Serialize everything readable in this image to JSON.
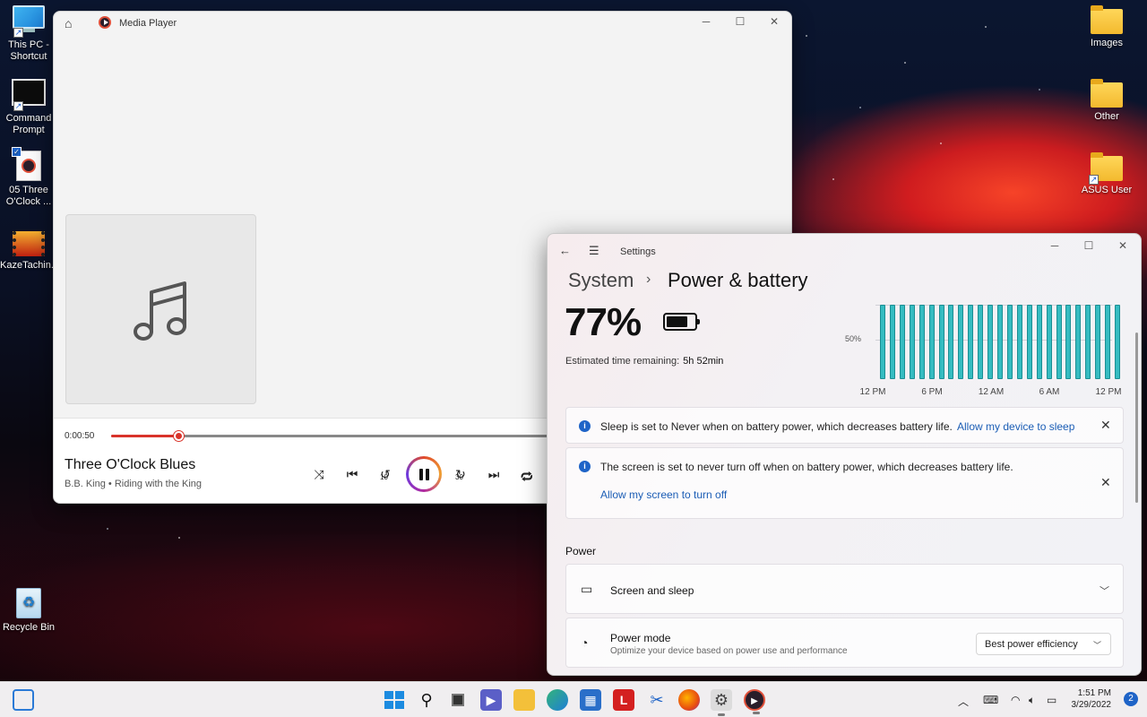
{
  "desktop": {
    "icons_left": [
      {
        "label": "This PC - Shortcut",
        "icon": "monitor-icon"
      },
      {
        "label": "Command Prompt",
        "icon": "terminal-icon"
      },
      {
        "label": "05 Three O'Clock ...",
        "icon": "media-file-icon"
      },
      {
        "label": "KazeTachin...",
        "icon": "video-file-icon"
      },
      {
        "label": "Recycle Bin",
        "icon": "recycle-bin-icon"
      }
    ],
    "icons_right": [
      {
        "label": "Images",
        "icon": "folder-icon"
      },
      {
        "label": "Other",
        "icon": "folder-icon"
      },
      {
        "label": "ASUS User",
        "icon": "folder-icon"
      }
    ]
  },
  "media_player": {
    "window_title": "Media Player",
    "current_time": "0:00:50",
    "progress": 0.15,
    "track_title": "Three O'Clock Blues",
    "track_subtitle": "B.B. King • Riding with the King",
    "skip_back_label": "10",
    "skip_forward_label": "30"
  },
  "settings": {
    "window_title": "Settings",
    "breadcrumb_parent": "System",
    "breadcrumb_sep": "›",
    "page_title": "Power & battery",
    "battery_percent": "77%",
    "battery_level": 0.77,
    "est_label": "Estimated time remaining:",
    "est_value": "5h 52min",
    "chart_data": {
      "type": "bar",
      "ylabel_tick": "50%",
      "x_tick_labels": [
        "12 PM",
        "6 PM",
        "12 AM",
        "6 AM",
        "12 PM"
      ],
      "values": [
        100,
        100,
        100,
        100,
        100,
        100,
        100,
        100,
        100,
        100,
        100,
        100,
        100,
        100,
        100,
        100,
        100,
        100,
        100,
        100,
        100,
        100,
        100,
        100,
        100
      ],
      "ylim": [
        0,
        100
      ]
    },
    "notice_sleep": {
      "text": "Sleep is set to Never when on battery power, which decreases battery life.",
      "link": "Allow my device to sleep"
    },
    "notice_screen": {
      "text": "The screen is set to never turn off when on battery power, which decreases battery life.",
      "link": "Allow my screen to turn off"
    },
    "section_power": "Power",
    "card_screen_sleep": "Screen and sleep",
    "card_power_mode": {
      "title": "Power mode",
      "subtitle": "Optimize your device based on power use and performance",
      "value": "Best power efficiency"
    }
  },
  "taskbar": {
    "time": "1:51 PM",
    "date": "3/29/2022",
    "notification_count": "2",
    "colors": {
      "accent": "#1e63c7",
      "media_accent": "#d9332a",
      "chart_bar": "#35bcc1"
    }
  }
}
